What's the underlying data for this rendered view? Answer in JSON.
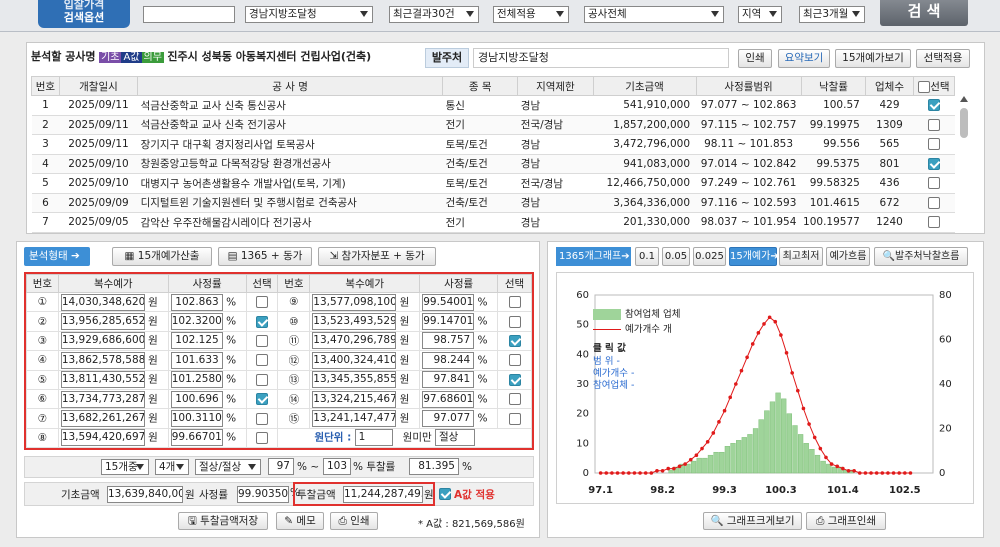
{
  "topbar": {
    "title_line1": "입찰가격",
    "title_line2": "검색옵션",
    "search_value": "",
    "sel_org": "경남지방조달청",
    "sel_recent": "최근결과30건",
    "sel_apply": "전체적용",
    "sel_type": "공사전체",
    "sel_region": "지역",
    "sel_period": "최근3개월",
    "search_btn": "검 색"
  },
  "analysis": {
    "label": "분석할 공사명",
    "badges": [
      "기초",
      "A값",
      "의무"
    ],
    "project": "진주시 성북동 아동복지센터 건립사업(건축)",
    "orderer_label": "발주처",
    "orderer": "경남지방조달청",
    "buttons": [
      "인쇄",
      "요약보기",
      "15개예가보기",
      "선택적용"
    ]
  },
  "list": {
    "headers": [
      "번호",
      "개찰일시",
      "공 사 명",
      "종 목",
      "지역제한",
      "기초금액",
      "사정률범위",
      "낙찰률",
      "업체수",
      "선택"
    ],
    "rows": [
      {
        "no": "1",
        "date": "2025/09/11",
        "name": "석금산중학교 교사 신축 통신공사",
        "type": "통신",
        "region": "경남",
        "base": "541,910,000",
        "range": "97.077 ~ 102.863",
        "rate": "100.57",
        "count": "429",
        "checked": true
      },
      {
        "no": "2",
        "date": "2025/09/11",
        "name": "석금산중학교 교사 신축 전기공사",
        "type": "전기",
        "region": "전국/경남",
        "base": "1,857,200,000",
        "range": "97.115 ~ 102.757",
        "rate": "99.19975",
        "count": "1309",
        "checked": false
      },
      {
        "no": "3",
        "date": "2025/09/11",
        "name": "장기지구 대구획 경지정리사업 토목공사",
        "type": "토목/토건",
        "region": "경남",
        "base": "3,472,796,000",
        "range": "98.11 ~ 101.853",
        "rate": "99.556",
        "count": "565",
        "checked": false
      },
      {
        "no": "4",
        "date": "2025/09/10",
        "name": "창원중앙고등학교 다목적강당 환경개선공사",
        "type": "건축/토건",
        "region": "경남",
        "base": "941,083,000",
        "range": "97.014 ~ 102.842",
        "rate": "99.5375",
        "count": "801",
        "checked": true
      },
      {
        "no": "5",
        "date": "2025/09/10",
        "name": "대병지구 농어촌생활용수 개발사업(토목, 기계)",
        "type": "토목/토건",
        "region": "전국/경남",
        "base": "12,466,750,000",
        "range": "97.249 ~ 102.761",
        "rate": "99.58325",
        "count": "436",
        "checked": false
      },
      {
        "no": "6",
        "date": "2025/09/09",
        "name": "디지털트윈 기술지원센터 및 주행시험로 건축공사",
        "type": "건축/토건",
        "region": "경남",
        "base": "3,364,336,000",
        "range": "97.116 ~ 102.593",
        "rate": "101.4615",
        "count": "672",
        "checked": false
      },
      {
        "no": "7",
        "date": "2025/09/05",
        "name": "감악산 우주잔해물감시레이다 전기공사",
        "type": "전기",
        "region": "경남",
        "base": "201,330,000",
        "range": "98.037 ~ 101.954",
        "rate": "100.19577",
        "count": "1240",
        "checked": false
      }
    ]
  },
  "toolbar": {
    "type_btn": "분석형태",
    "b1": "15개예가산출",
    "b2": "1365 + 동가",
    "b3": "참가자분포 + 동가"
  },
  "calc": {
    "headers": [
      "번호",
      "복수예가",
      "사정률",
      "선택"
    ],
    "unit_won": "원",
    "unit_pct": "%",
    "left": [
      {
        "no": "①",
        "amount": "14,030,348,620",
        "rate": "102.863",
        "checked": false
      },
      {
        "no": "②",
        "amount": "13,956,285,652",
        "rate": "102.32001",
        "checked": true
      },
      {
        "no": "③",
        "amount": "13,929,686,600",
        "rate": "102.125",
        "checked": false
      },
      {
        "no": "④",
        "amount": "13,862,578,588",
        "rate": "101.633",
        "checked": false
      },
      {
        "no": "⑤",
        "amount": "13,811,430,552",
        "rate": "101.25801",
        "checked": false
      },
      {
        "no": "⑥",
        "amount": "13,734,773,287",
        "rate": "100.696",
        "checked": true
      },
      {
        "no": "⑦",
        "amount": "13,682,261,267",
        "rate": "100.31101",
        "checked": false
      },
      {
        "no": "⑧",
        "amount": "13,594,420,697",
        "rate": "99.66701",
        "checked": false
      }
    ],
    "right": [
      {
        "no": "⑨",
        "amount": "13,577,098,100",
        "rate": "99.54001",
        "checked": false
      },
      {
        "no": "⑩",
        "amount": "13,523,493,529",
        "rate": "99.14701",
        "checked": false
      },
      {
        "no": "⑪",
        "amount": "13,470,296,789",
        "rate": "98.757",
        "checked": true
      },
      {
        "no": "⑫",
        "amount": "13,400,324,410",
        "rate": "98.244",
        "checked": false
      },
      {
        "no": "⑬",
        "amount": "13,345,355,855",
        "rate": "97.841",
        "checked": true
      },
      {
        "no": "⑭",
        "amount": "13,324,215,467",
        "rate": "97.68601",
        "checked": false
      },
      {
        "no": "⑮",
        "amount": "13,241,147,477",
        "rate": "97.077",
        "checked": false
      }
    ],
    "unit_label": "원단위 :",
    "unit_value": "1",
    "below_label": "원미만",
    "below_value": "절상"
  },
  "settings": {
    "s1": "15개중",
    "s2": "4개",
    "s3": "절상/절상",
    "v1": "97",
    "pct_tilde": "% ~",
    "v2": "103",
    "rate_label": "% 투찰률",
    "v3": "81.395",
    "pct": "%"
  },
  "result": {
    "base_label": "기초금액",
    "base_value": "13,639,840,000",
    "won": "원",
    "adj_label": "사정률",
    "adj_value": "99.90350",
    "pct": "%",
    "bid_label": "투찰금액",
    "bid_value": "11,244,287,495",
    "apply_label": "A값 적용"
  },
  "actions": {
    "save": "투찰금액저장",
    "memo": "메모",
    "print": "인쇄",
    "avalue": "* A값 : 821,569,586원"
  },
  "chart_toolbar": {
    "tab": "1365개그래프",
    "b1": "0.1",
    "b2": "0.05",
    "b3": "0.025",
    "b4": "15개예가",
    "b5": "최고최저",
    "b6": "예가흐름",
    "b7": "발주처낙찰흐름"
  },
  "chart_legend": {
    "bar": "참여업체 업체",
    "line": "예가개수 개",
    "info_title": "클 릭 값",
    "info_range": "범 위 -",
    "info_count": "예가개수 -",
    "info_part": "참여업체 -"
  },
  "chart_buttons": {
    "zoom": "그래프크게보기",
    "print": "그래프인쇄"
  },
  "colors": {
    "bar": "#9fd49a",
    "line": "#e01a1a",
    "accent": "#3d8fd6",
    "alert": "#e0312e"
  },
  "chart_data": {
    "type": "bar",
    "title": "",
    "x_ticks": [
      97.1,
      98.2,
      99.3,
      100.3,
      101.4,
      102.5
    ],
    "xlim": [
      97.0,
      103.0
    ],
    "ylim_left": [
      0,
      60
    ],
    "yticks_left": [
      0,
      10,
      20,
      30,
      40,
      50,
      60
    ],
    "ylim_right": [
      0,
      80
    ],
    "yticks_right": [
      0,
      20,
      40,
      60,
      80
    ],
    "series": [
      {
        "name": "참여업체",
        "type": "bar",
        "x": [
          98.35,
          98.45,
          98.55,
          98.65,
          98.75,
          98.85,
          98.95,
          99.05,
          99.15,
          99.25,
          99.35,
          99.45,
          99.55,
          99.65,
          99.75,
          99.85,
          99.95,
          100.05,
          100.15,
          100.25,
          100.35,
          100.45,
          100.55,
          100.65,
          100.75,
          100.85,
          100.95,
          101.05,
          101.15,
          101.25,
          101.35,
          101.45,
          101.55
        ],
        "values": [
          1,
          2,
          3,
          3,
          4,
          5,
          5,
          6,
          7,
          7,
          9,
          10,
          11,
          12,
          13,
          15,
          18,
          21,
          24,
          27,
          25,
          20,
          16,
          13,
          10,
          8,
          6,
          4,
          3,
          2,
          2,
          1,
          1
        ]
      },
      {
        "name": "예가개수",
        "type": "line",
        "x": [
          97.1,
          97.2,
          97.3,
          97.4,
          97.5,
          97.6,
          97.7,
          97.8,
          97.9,
          98.0,
          98.1,
          98.2,
          98.3,
          98.4,
          98.5,
          98.6,
          98.7,
          98.8,
          98.9,
          99.0,
          99.1,
          99.2,
          99.3,
          99.4,
          99.5,
          99.6,
          99.7,
          99.8,
          99.9,
          100.0,
          100.1,
          100.2,
          100.3,
          100.4,
          100.5,
          100.6,
          100.7,
          100.8,
          100.9,
          101.0,
          101.1,
          101.2,
          101.3,
          101.4,
          101.5,
          101.6,
          101.7,
          101.8,
          101.9,
          102.0,
          102.1,
          102.2,
          102.3,
          102.4,
          102.5,
          102.6
        ],
        "values": [
          0,
          0,
          0,
          0,
          0,
          0,
          0,
          0,
          0,
          0,
          1,
          1,
          2,
          2,
          3,
          4,
          6,
          8,
          11,
          14,
          18,
          23,
          28,
          34,
          40,
          46,
          52,
          58,
          63,
          67,
          70,
          68,
          62,
          54,
          45,
          37,
          29,
          22,
          16,
          11,
          7,
          4,
          3,
          2,
          1,
          1,
          0,
          0,
          0,
          0,
          0,
          0,
          0,
          0,
          0,
          0
        ]
      }
    ]
  }
}
